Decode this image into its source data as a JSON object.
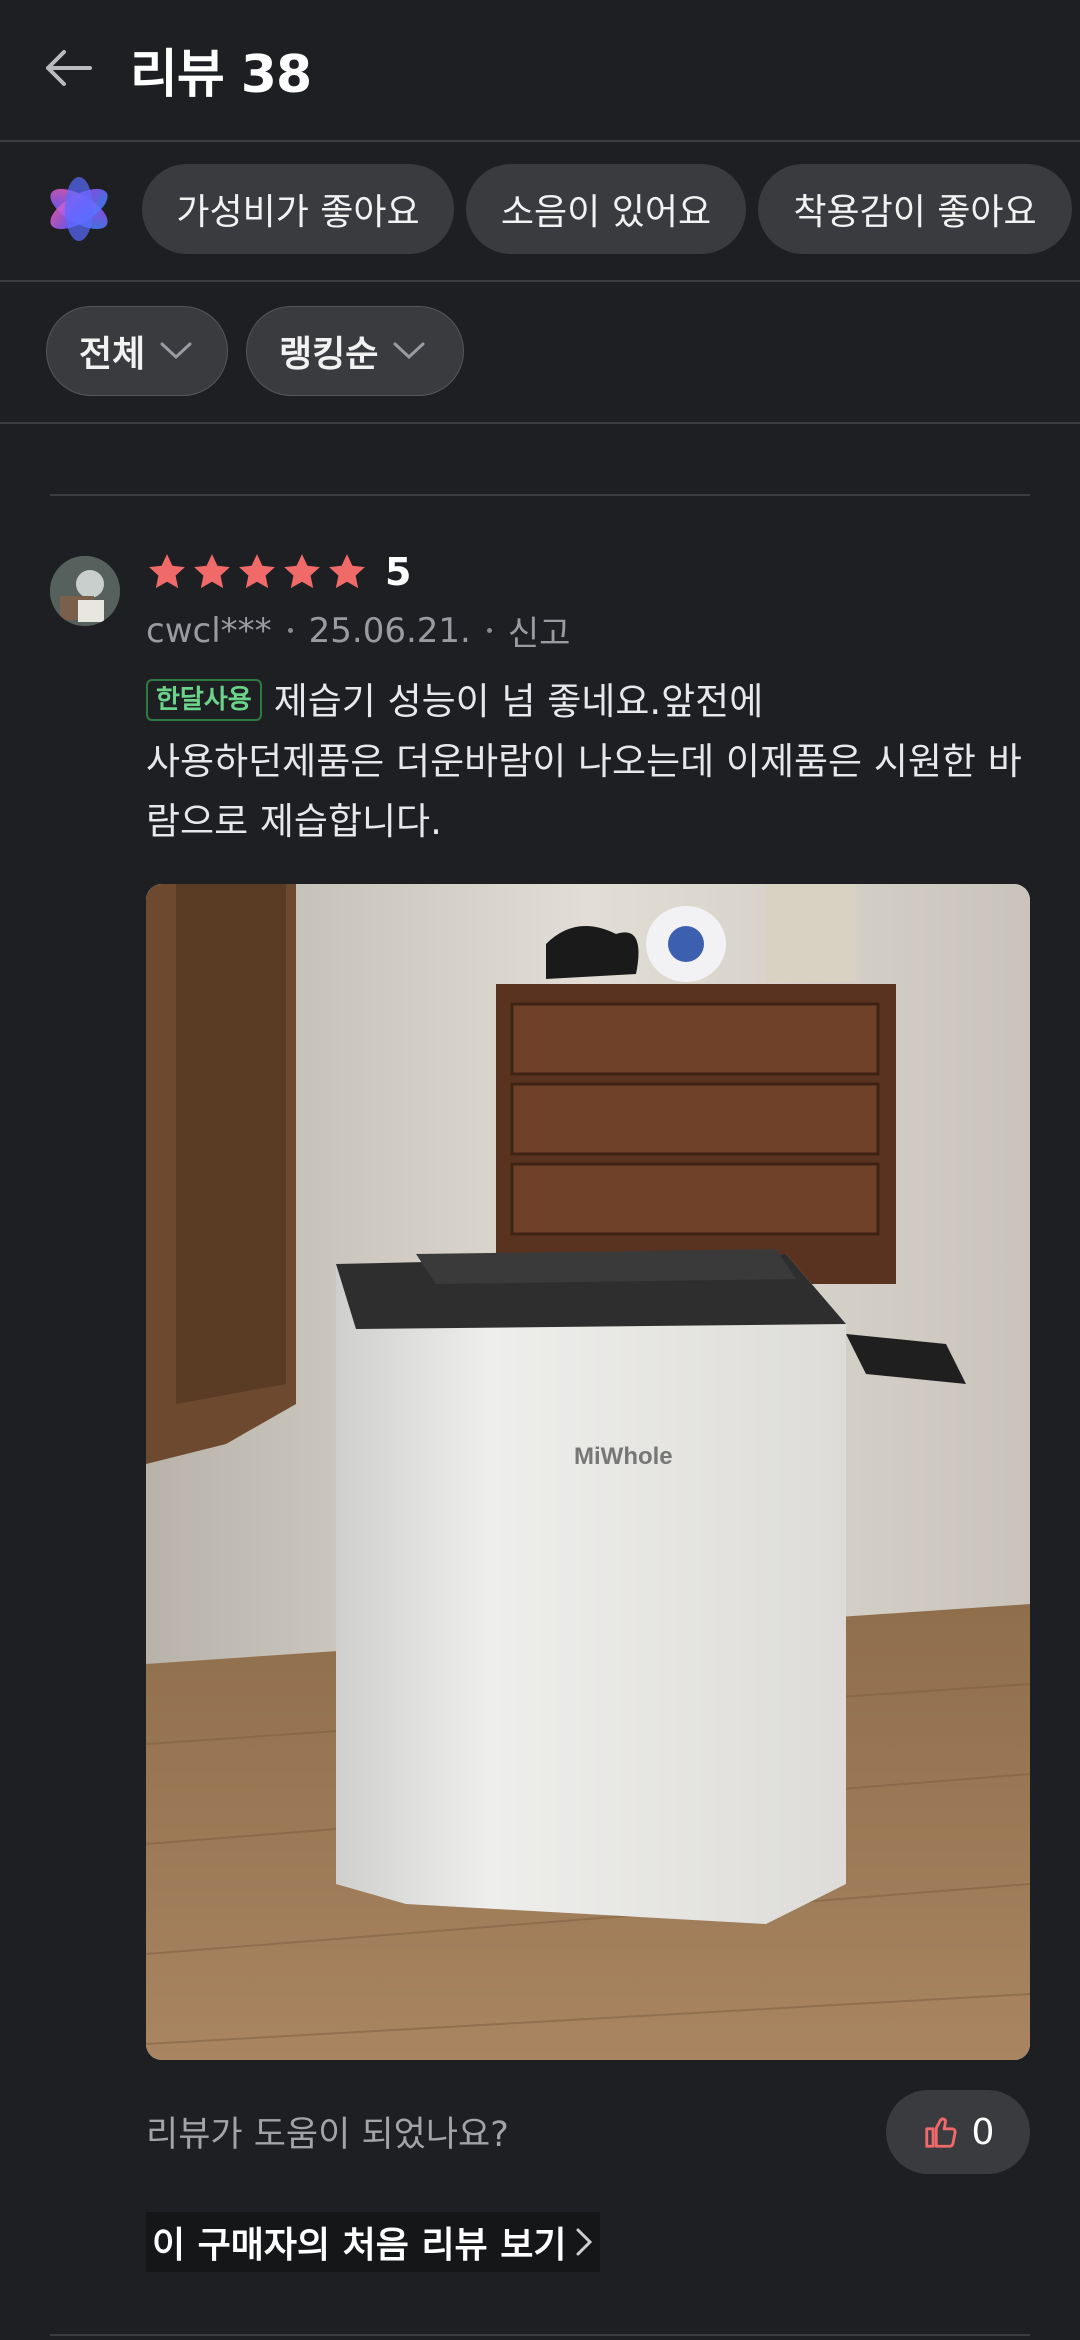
{
  "header": {
    "title": "리뷰 38",
    "back_icon": "arrow-left-icon"
  },
  "keywords": {
    "ai_icon": "sparkle-ai-icon",
    "chips": [
      "가성비가 좋아요",
      "소음이 있어요",
      "착용감이 좋아요"
    ]
  },
  "filters": {
    "scope_label": "전체",
    "sort_label": "랭킹순"
  },
  "review": {
    "stars": 5,
    "rating_text": "5",
    "star_color": "#f06a6a",
    "author": "cwcl***",
    "date": "25.06.21.",
    "report_label": "신고",
    "badge": "한달사용",
    "text_line1": "제습기 성능이 넘 좋네요.앞전에",
    "text_rest": "사용하던제품은 더운바람이 나오는데 이제품은 시원한 바람으로 제습합니다.",
    "photo_brand": "MiWhole",
    "helpful_question": "리뷰가 도움이 되었나요?",
    "like_count": "0",
    "first_review_link": "이 구매자의 처음 리뷰 보기"
  },
  "colors": {
    "background": "#1e1f22",
    "chip": "#3a3b3f",
    "badge_green": "#6bd48a"
  }
}
